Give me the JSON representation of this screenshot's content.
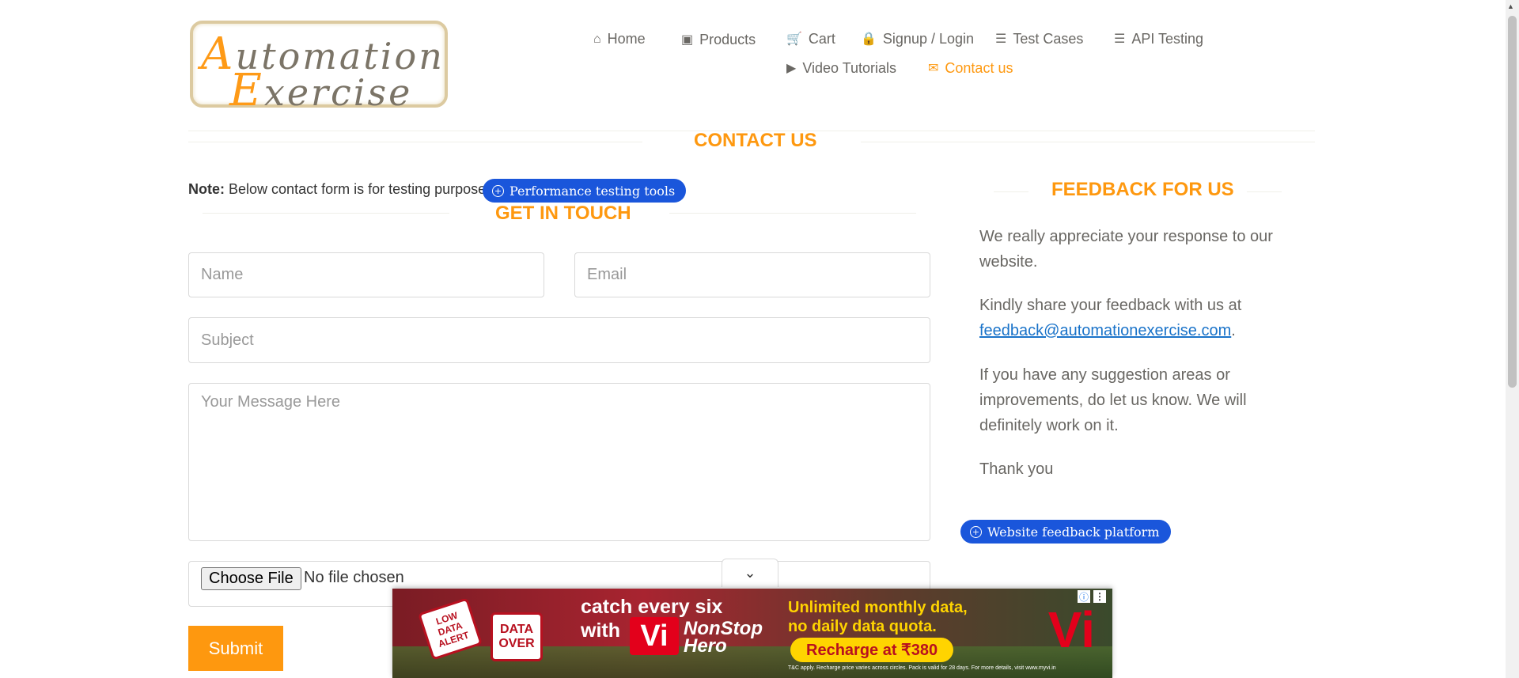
{
  "logo": {
    "line1_first": "A",
    "line1_rest": "utomation",
    "line2_first": "E",
    "line2_rest": "xercise"
  },
  "nav": {
    "items": [
      {
        "label": "Home",
        "icon": "home-icon",
        "glyph": "⌂"
      },
      {
        "label": "Products",
        "icon": "briefcase-icon",
        "glyph": "▣"
      },
      {
        "label": "Cart",
        "icon": "cart-icon",
        "glyph": "🛒"
      },
      {
        "label": "Signup / Login",
        "icon": "lock-icon",
        "glyph": "🔒"
      },
      {
        "label": "Test Cases",
        "icon": "list-icon",
        "glyph": "☰"
      },
      {
        "label": "API Testing",
        "icon": "list-icon",
        "glyph": "☰"
      },
      {
        "label": "Video Tutorials",
        "icon": "youtube-icon",
        "glyph": "▶"
      },
      {
        "label": "Contact us",
        "icon": "envelope-icon",
        "glyph": "✉"
      }
    ],
    "active_color": "#fe980f"
  },
  "page_title": "CONTACT US",
  "note": {
    "bold": "Note:",
    "text": "Below contact form is for testing purpose."
  },
  "perf_pill": {
    "label": "Performance testing tools",
    "glyph": "+"
  },
  "form": {
    "title": "GET IN TOUCH",
    "name_placeholder": "Name",
    "email_placeholder": "Email",
    "subject_placeholder": "Subject",
    "message_placeholder": "Your Message Here",
    "choose_file_label": "Choose File",
    "no_file_text": "No file chosen",
    "submit_label": "Submit"
  },
  "feedback": {
    "title": "FEEDBACK FOR US",
    "para1": "We really appreciate your response to our website.",
    "para2_prefix": "Kindly share your feedback with us at",
    "email": "feedback@automationexercise.com",
    "para2_suffix": ".",
    "para3": "If you have any suggestion areas or improvements, do let us know. We will definitely work on it.",
    "thanks": "Thank you"
  },
  "feedback_pill": {
    "label": "Website feedback platform",
    "glyph": "+"
  },
  "ad": {
    "collapse_glyph": "⌄",
    "sign1": "LOW DATA ALERT",
    "sign2": "DATA OVER",
    "headline_line1": "catch every six",
    "headline_line2": "with",
    "vi": "Vi",
    "brand_line1": "NonStop",
    "brand_line2": "Hero",
    "offer_line1": "Unlimited monthly data,",
    "offer_line2": "no daily data quota.",
    "cta": "Recharge at ₹380",
    "fine_print": "T&C apply. Recharge price varies across circles. Pack is valid for 28 days. For more details, visit www.myvi.in",
    "logo": "Vi",
    "info_glyph": "ⓘ",
    "menu_glyph": "⋮"
  },
  "colors": {
    "accent": "#fe980f",
    "pill_blue": "#1a56db",
    "link": "#1a73c9"
  }
}
